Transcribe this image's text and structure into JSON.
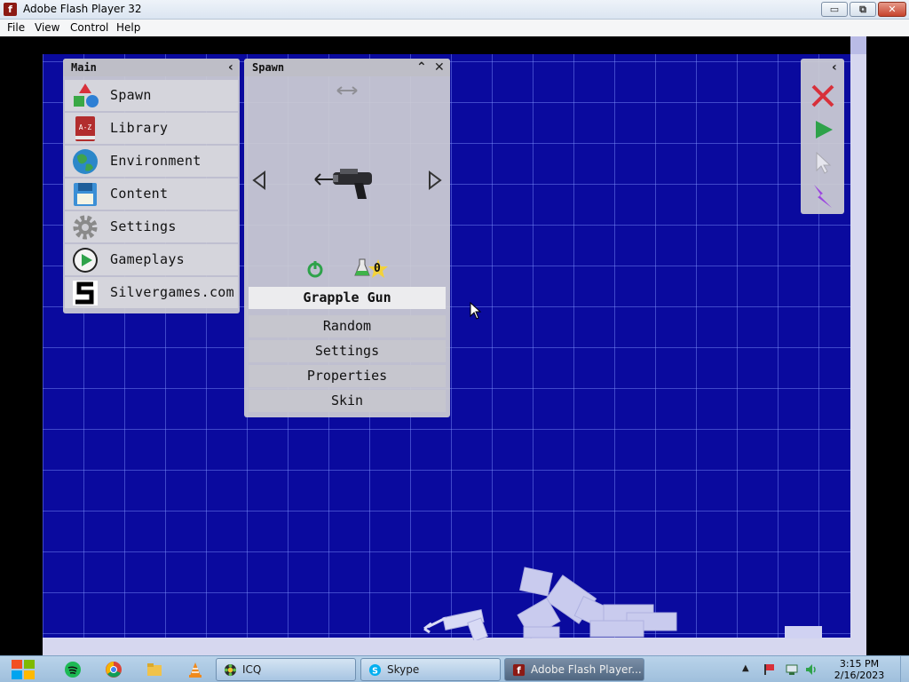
{
  "window": {
    "title": "Adobe Flash Player 32",
    "controls": {
      "minimize": "▭",
      "maximize": "⧉",
      "close": "✕"
    }
  },
  "menubar": [
    "File",
    "View",
    "Control",
    "Help"
  ],
  "main_panel": {
    "title": "Main",
    "collapse_icon": "‹",
    "items": [
      {
        "label": "Spawn",
        "icon": "shapes-icon"
      },
      {
        "label": "Library",
        "icon": "book-a-z-icon"
      },
      {
        "label": "Environment",
        "icon": "globe-icon"
      },
      {
        "label": "Content",
        "icon": "floppy-disk-icon"
      },
      {
        "label": "Settings",
        "icon": "gear-icon"
      },
      {
        "label": "Gameplays",
        "icon": "play-circle-icon"
      },
      {
        "label": "Silvergames.com",
        "icon": "silvergames-logo-icon"
      }
    ]
  },
  "spawn_panel": {
    "title": "Spawn",
    "collapse_icon": "⌃",
    "close_icon": "✕",
    "selected_item": "Grapple Gun",
    "counter": "0",
    "buttons": [
      "Random",
      "Settings",
      "Properties",
      "Skin"
    ]
  },
  "tools_panel": {
    "collapse_icon": "‹",
    "tools": [
      "delete-x-icon",
      "play-icon",
      "cursor-icon",
      "lightning-icon"
    ]
  },
  "taskbar": {
    "tasks": [
      {
        "label": "ICQ",
        "icon": "icq-icon",
        "active": false
      },
      {
        "label": "Skype",
        "icon": "skype-icon",
        "active": false
      },
      {
        "label": "Adobe Flash Player...",
        "icon": "flash-icon",
        "active": true
      }
    ],
    "clock_time": "3:15 PM",
    "clock_date": "2/16/2023"
  },
  "colors": {
    "stage_blue": "#0a0a9e",
    "grid_line": "#8296ff",
    "panel_gray": "#cdcdd4",
    "selected_row": "#ececee"
  }
}
